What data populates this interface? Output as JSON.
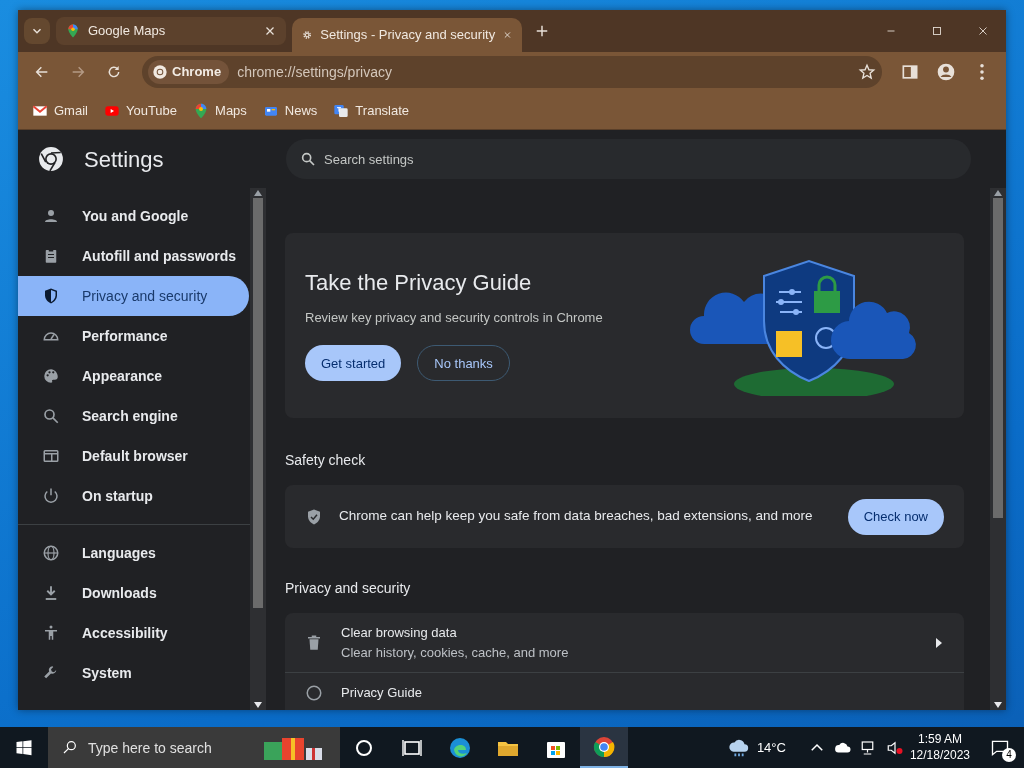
{
  "tabs": [
    {
      "title": "Google Maps",
      "selected": false
    },
    {
      "title": "Settings - Privacy and security",
      "selected": true
    }
  ],
  "address_bar": {
    "chip": "Chrome",
    "url": "chrome://settings/privacy"
  },
  "bookmarks": [
    {
      "label": "Gmail"
    },
    {
      "label": "YouTube"
    },
    {
      "label": "Maps"
    },
    {
      "label": "News"
    },
    {
      "label": "Translate"
    }
  ],
  "settings": {
    "title": "Settings",
    "search": {
      "placeholder": "Search settings"
    }
  },
  "sidebar": {
    "groups": [
      {
        "items": [
          {
            "label": "You and Google",
            "selected": false
          },
          {
            "label": "Autofill and passwords",
            "selected": false
          },
          {
            "label": "Privacy and security",
            "selected": true
          },
          {
            "label": "Performance",
            "selected": false
          },
          {
            "label": "Appearance",
            "selected": false
          },
          {
            "label": "Search engine",
            "selected": false
          },
          {
            "label": "Default browser",
            "selected": false
          },
          {
            "label": "On startup",
            "selected": false
          }
        ]
      },
      {
        "items": [
          {
            "label": "Languages",
            "selected": false
          },
          {
            "label": "Downloads",
            "selected": false
          },
          {
            "label": "Accessibility",
            "selected": false
          },
          {
            "label": "System",
            "selected": false
          }
        ]
      }
    ]
  },
  "privacy_guide": {
    "title": "Take the Privacy Guide",
    "description": "Review key privacy and security controls in Chrome",
    "buttons": [
      {
        "label": "Get started",
        "kind": "primary"
      },
      {
        "label": "No thanks",
        "kind": "outline"
      }
    ]
  },
  "safety_check": {
    "heading": "Safety check",
    "text": "Chrome can help keep you safe from data breaches, bad extensions, and more",
    "button": "Check now"
  },
  "privacy_section": {
    "heading": "Privacy and security",
    "rows": [
      {
        "title": "Clear browsing data",
        "subtitle": "Clear history, cookies, cache, and more"
      },
      {
        "title": "Privacy Guide"
      }
    ]
  },
  "taskbar": {
    "search_placeholder": "Type here to search",
    "weather": "14°C",
    "time": "1:59 AM",
    "date": "12/18/2023",
    "notifications": "4"
  }
}
